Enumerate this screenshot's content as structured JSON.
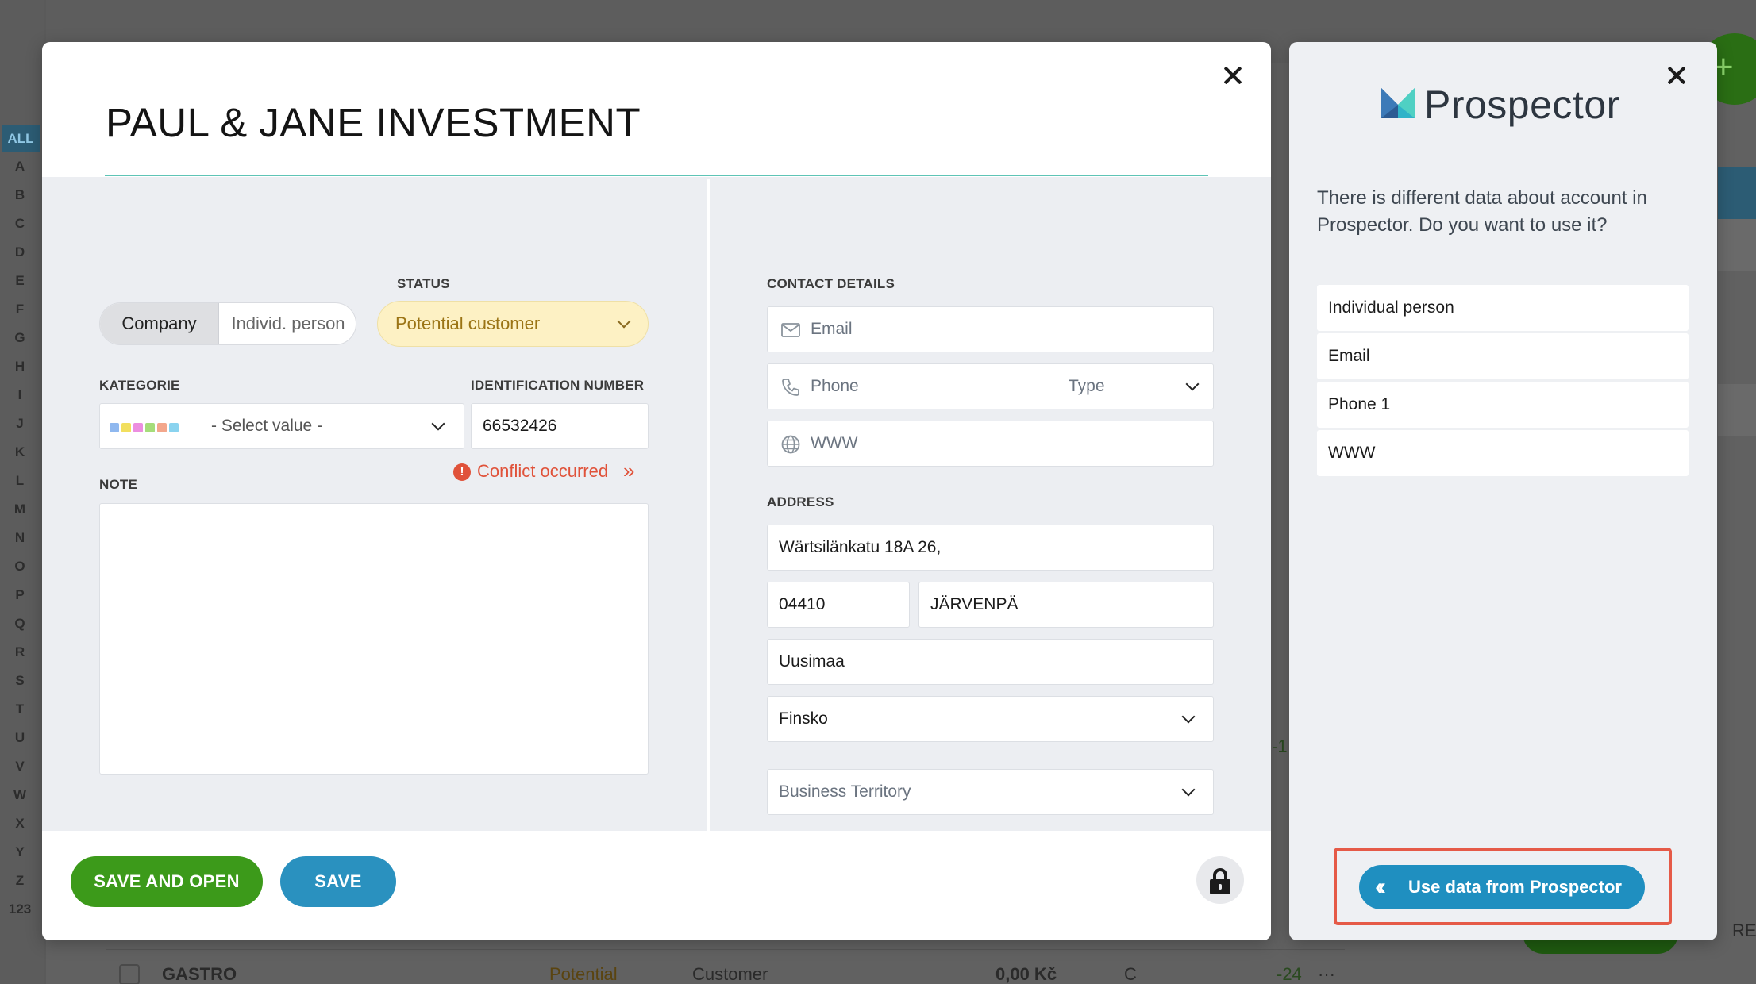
{
  "background": {
    "alphabet": [
      "ALL",
      "A",
      "B",
      "C",
      "D",
      "E",
      "F",
      "G",
      "H",
      "I",
      "J",
      "K",
      "L",
      "M",
      "N",
      "O",
      "P",
      "Q",
      "R",
      "S",
      "T",
      "U",
      "V",
      "W",
      "X",
      "Y",
      "Z",
      "123"
    ],
    "row": {
      "name": "GASTRO",
      "status": "Potential",
      "type": "Customer",
      "amount": "0,00 Kč",
      "rating": "C",
      "value": "-24",
      "more": "···"
    },
    "fab_label": "+",
    "partial_right": "RE",
    "partial_value": "-1"
  },
  "modal": {
    "title": "PAUL & JANE INVESTMENT",
    "status_label": "STATUS",
    "status_value": "Potential customer",
    "type_toggle": {
      "company": "Company",
      "person": "Individ. person",
      "selected": "Company"
    },
    "kategorie": {
      "label": "KATEGORIE",
      "placeholder": "- Select value -",
      "colors": [
        "#8fb8ef",
        "#f2df5e",
        "#ec8ee0",
        "#a6dd7a",
        "#f3a78c",
        "#8ad3ef"
      ]
    },
    "identification": {
      "label": "IDENTIFICATION NUMBER",
      "value": "66532426"
    },
    "conflict_text": "Conflict occurred",
    "conflict_arrow": "»",
    "note_label": "NOTE",
    "note_value": "",
    "contact": {
      "label": "CONTACT DETAILS",
      "email_placeholder": "Email",
      "phone_placeholder": "Phone",
      "type_placeholder": "Type",
      "www_placeholder": "WWW"
    },
    "address": {
      "label": "ADDRESS",
      "street": "Wärtsilänkatu 18A 26,",
      "zip": "04410",
      "city": "JÄRVENPÄ",
      "region": "Uusimaa",
      "country": "Finsko",
      "territory_placeholder": "Business Territory"
    },
    "footer": {
      "save_open": "SAVE AND OPEN",
      "save": "SAVE"
    },
    "colors": {
      "accent_line": "#5ec4b6",
      "save_open": "#3c9a1a",
      "save": "#2a91bf",
      "conflict": "#e0523a",
      "status_bg": "#fdf1c4"
    }
  },
  "prospector": {
    "brand": "Prospector",
    "message": "There is different data about account in Prospector. Do you want to use it?",
    "diff_items": [
      "Individual person",
      "Email",
      "Phone 1",
      "WWW"
    ],
    "use_button": "Use data from Prospector",
    "colors": {
      "button": "#1f8fc0",
      "highlight": "#e55a47"
    }
  }
}
